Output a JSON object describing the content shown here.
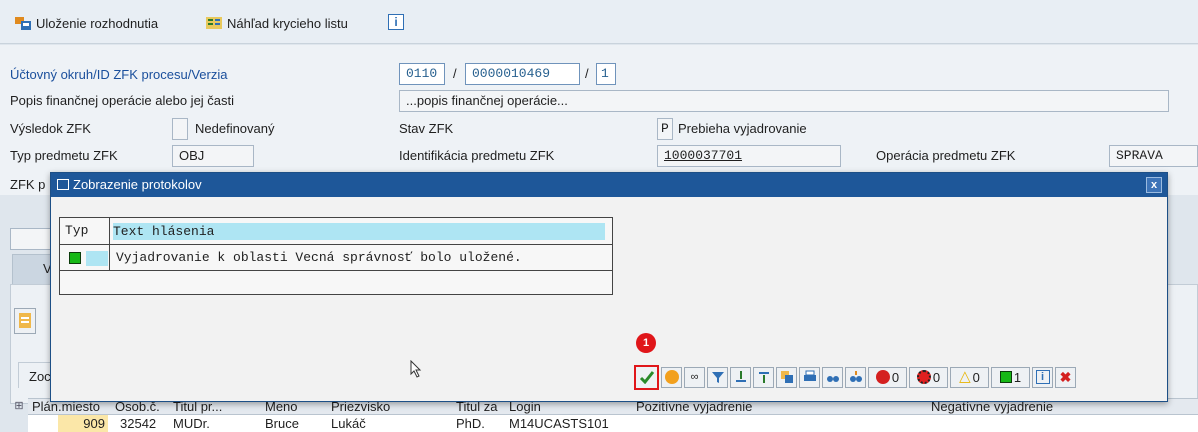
{
  "toolbar": {
    "save_decision_label": "Uloženie rozhodnutia",
    "cover_sheet_label": "Náhľad krycieho listu"
  },
  "form": {
    "row1": {
      "label": "Účtovný okruh/ID ZFK procesu/Verzia",
      "company_code": "0110",
      "sep1": "/",
      "process_id": "0000010469",
      "sep2": "/",
      "version": "1"
    },
    "row2": {
      "label": "Popis finančnej operácie alebo jej časti",
      "value": "...popis finančnej operácie..."
    },
    "row3": {
      "label": "Výsledok ZFK",
      "result_code": "",
      "result_text": "Nedefinovaný",
      "status_label": "Stav ZFK",
      "status_code": "P",
      "status_text": "Prebieha vyjadrovanie"
    },
    "row4": {
      "label": "Typ predmetu ZFK",
      "subject_type": "OBJ",
      "ident_label": "Identifikácia predmetu ZFK",
      "ident_value": "1000037701",
      "operation_label": "Operácia predmetu ZFK",
      "operation_value": "SPRAVA"
    },
    "row5": {
      "label_partial": "ZFK p"
    }
  },
  "dialog": {
    "title": "Zobrazenie protokolov",
    "close": "x",
    "table": {
      "header_type": "Typ",
      "header_text": "Text hlásenia",
      "rows": [
        {
          "status": "success",
          "text": "Vyjadrovanie k oblasti Vecná správnosť bolo uložené."
        }
      ]
    },
    "badge": "1",
    "counts": {
      "stop": "0",
      "error": "0",
      "warning": "0",
      "success": "1"
    }
  },
  "background": {
    "tab_partial": "V",
    "section_partial": "Zoc",
    "grid": {
      "headers": [
        "Plán.miesto",
        "Osob.č.",
        "Titul pr...",
        "Meno",
        "Priezvisko",
        "Titul za",
        "Login",
        "Pozitívne vyjadrenie",
        "Negatívne vyjadrenie"
      ],
      "row": [
        "909",
        "32542",
        "MUDr.",
        "Bruce",
        "Lukáč",
        "PhD.",
        "M14UCASTS101",
        "",
        ""
      ]
    }
  },
  "colors": {
    "title_bar": "#1e5799",
    "highlight": "#aee5f3",
    "success": "#16b816",
    "annotation": "#e0161a"
  }
}
